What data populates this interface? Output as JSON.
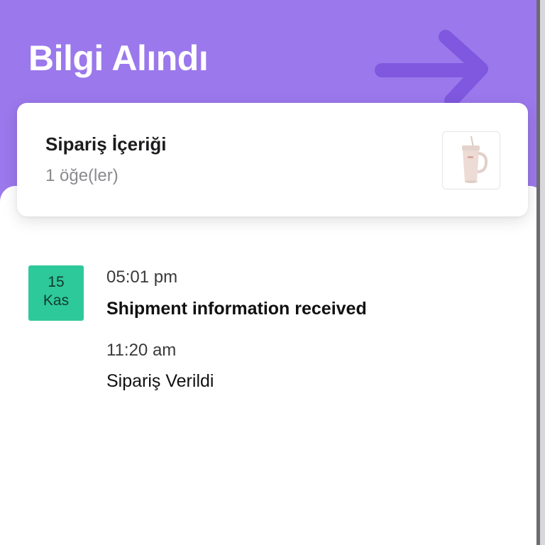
{
  "header": {
    "title": "Bilgi Alındı",
    "background_color": "#9b78ec",
    "decoration_icon": "arrow-right-icon"
  },
  "order_card": {
    "title": "Sipariş İçeriği",
    "subtitle": "1 öğe(ler)",
    "thumbnail_icon": "tumbler-cup-icon"
  },
  "timeline": {
    "date": {
      "day": "15",
      "month": "Kas",
      "badge_color": "#2ec99b"
    },
    "events": [
      {
        "time": "05:01 pm",
        "description": "Shipment information received"
      },
      {
        "time": "11:20 am",
        "description": "Sipariş Verildi"
      }
    ]
  }
}
